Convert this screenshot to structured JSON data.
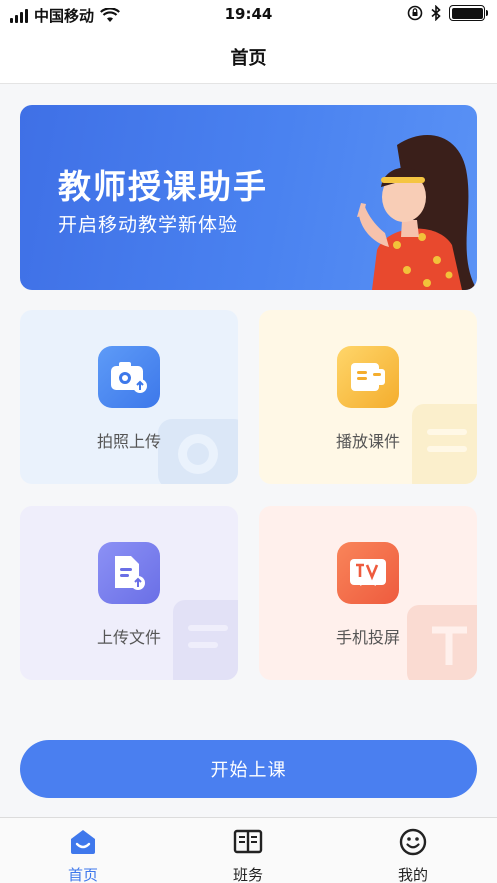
{
  "status_bar": {
    "carrier": "中国移动",
    "time": "19:44",
    "battery_level_pct": 100,
    "icons": [
      "signal-icon",
      "wifi-icon",
      "orientation-lock-icon",
      "bluetooth-icon",
      "battery-icon"
    ]
  },
  "header": {
    "title": "首页"
  },
  "banner": {
    "title": "教师授课助手",
    "subtitle": "开启移动教学新体验"
  },
  "features": [
    {
      "label": "拍照上传",
      "icon": "camera-upload-icon",
      "color": "#3d78ea"
    },
    {
      "label": "播放课件",
      "icon": "play-courseware-icon",
      "color": "#f4ad2d"
    },
    {
      "label": "上传文件",
      "icon": "file-upload-icon",
      "color": "#6a6fe6"
    },
    {
      "label": "手机投屏",
      "icon": "tv-cast-icon",
      "color": "#ee5b3e"
    }
  ],
  "start_button": {
    "label": "开始上课"
  },
  "tab_bar": {
    "active_index": 0,
    "accent_color": "#3f78ec",
    "items": [
      {
        "label": "首页",
        "icon": "home-icon"
      },
      {
        "label": "班务",
        "icon": "book-icon"
      },
      {
        "label": "我的",
        "icon": "smiley-icon"
      }
    ]
  }
}
